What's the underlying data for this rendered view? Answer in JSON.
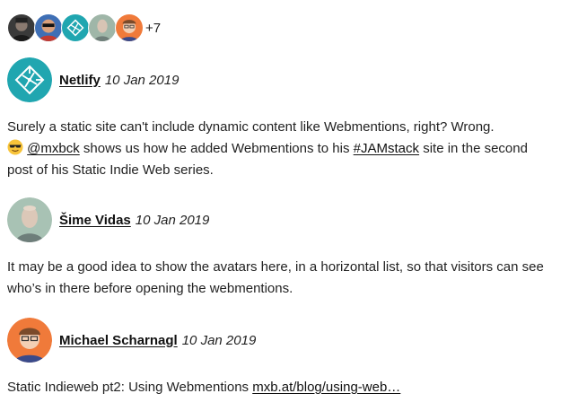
{
  "facepile": {
    "avatars": [
      {
        "name": "avatar-dark-person"
      },
      {
        "name": "avatar-person-sunglasses"
      },
      {
        "name": "avatar-netlify"
      },
      {
        "name": "avatar-sime-vidas"
      },
      {
        "name": "avatar-michael-scharnagl"
      }
    ],
    "more_count": "+7"
  },
  "mentions": [
    {
      "author": "Netlify",
      "date": "10 Jan 2019",
      "avatar_icon": "netlify-logo-icon",
      "body": {
        "text1": "Surely a static site can't include dynamic content like Webmentions, right? Wrong.",
        "emoji": "sunglasses-emoji-icon",
        "mention_link": "@mxbck",
        "text2": "shows us how he added Webmentions to his",
        "hashtag_link": "#JAMstack",
        "text3": "site in the second post of his Static Indie Web series."
      }
    },
    {
      "author": "Šime Vidas",
      "date": "10 Jan 2019",
      "body": {
        "text": "It may be a good idea to show the avatars here, in a horizontal list, so that visitors can see who’s in there before opening the webmentions."
      }
    },
    {
      "author": "Michael Scharnagl",
      "date": "10 Jan 2019",
      "body": {
        "text": "Static Indieweb pt2: Using Webmentions",
        "link": "mxb.at/blog/using-web…"
      }
    }
  ],
  "colors": {
    "netlify_teal": "#20a6b0",
    "orange_bg": "#f07a3a",
    "text": "#222222"
  }
}
